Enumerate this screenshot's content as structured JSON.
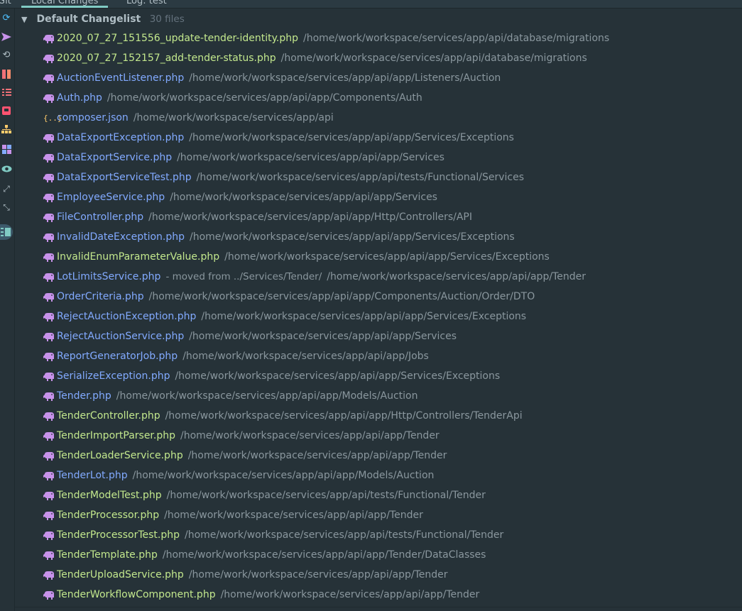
{
  "tabs": [
    {
      "label": "Git"
    },
    {
      "label": "Local Changes"
    },
    {
      "label": "Log: test"
    }
  ],
  "toolbar_icons": [
    "refresh-icon",
    "commit-arrow-icon",
    "rollback-icon",
    "diff-icon",
    "changelist-icon",
    "shelve-icon",
    "group-by-icon",
    "layout-icon",
    "preview-eye-icon",
    "expand-all-icon",
    "collapse-all-icon",
    "details-panel-icon"
  ],
  "colors": {
    "modified": "#82aaff",
    "added": "#c3e88d",
    "php_icon": "#c792ea",
    "accent": "#80cbc4"
  },
  "changelist": {
    "name": "Default Changelist",
    "count_label": "30 files",
    "files": [
      {
        "name": "2020_07_27_151556_update-tender-identity.php",
        "path": "/home/work/workspace/services/app/api/database/migrations",
        "status": "added",
        "icon": "php-elephant-icon"
      },
      {
        "name": "2020_07_27_152157_add-tender-status.php",
        "path": "/home/work/workspace/services/app/api/database/migrations",
        "status": "added",
        "icon": "php-elephant-icon"
      },
      {
        "name": "AuctionEventListener.php",
        "path": "/home/work/workspace/services/app/api/app/Listeners/Auction",
        "status": "modified",
        "icon": "php-elephant-icon"
      },
      {
        "name": "Auth.php",
        "path": "/home/work/workspace/services/app/api/app/Components/Auth",
        "status": "modified",
        "icon": "php-elephant-icon"
      },
      {
        "name": "composer.json",
        "path": "/home/work/workspace/services/app/api",
        "status": "modified",
        "icon": "json-braces-icon"
      },
      {
        "name": "DataExportException.php",
        "path": "/home/work/workspace/services/app/api/app/Services/Exceptions",
        "status": "modified",
        "icon": "php-elephant-icon"
      },
      {
        "name": "DataExportService.php",
        "path": "/home/work/workspace/services/app/api/app/Services",
        "status": "modified",
        "icon": "php-elephant-icon"
      },
      {
        "name": "DataExportServiceTest.php",
        "path": "/home/work/workspace/services/app/api/tests/Functional/Services",
        "status": "modified",
        "icon": "php-elephant-icon"
      },
      {
        "name": "EmployeeService.php",
        "path": "/home/work/workspace/services/app/api/app/Services",
        "status": "modified",
        "icon": "php-elephant-icon"
      },
      {
        "name": "FileController.php",
        "path": "/home/work/workspace/services/app/api/app/Http/Controllers/API",
        "status": "modified",
        "icon": "php-elephant-icon"
      },
      {
        "name": "InvalidDateException.php",
        "path": "/home/work/workspace/services/app/api/app/Services/Exceptions",
        "status": "modified",
        "icon": "php-elephant-icon"
      },
      {
        "name": "InvalidEnumParameterValue.php",
        "path": "/home/work/workspace/services/app/api/app/Services/Exceptions",
        "status": "added",
        "icon": "php-elephant-icon"
      },
      {
        "name": "LotLimitsService.php",
        "note": "- moved from ../Services/Tender/",
        "path": "/home/work/workspace/services/app/api/app/Tender",
        "status": "modified",
        "icon": "php-elephant-icon"
      },
      {
        "name": "OrderCriteria.php",
        "path": "/home/work/workspace/services/app/api/app/Components/Auction/Order/DTO",
        "status": "modified",
        "icon": "php-elephant-icon"
      },
      {
        "name": "RejectAuctionException.php",
        "path": "/home/work/workspace/services/app/api/app/Services/Exceptions",
        "status": "modified",
        "icon": "php-elephant-icon"
      },
      {
        "name": "RejectAuctionService.php",
        "path": "/home/work/workspace/services/app/api/app/Services",
        "status": "modified",
        "icon": "php-elephant-icon"
      },
      {
        "name": "ReportGeneratorJob.php",
        "path": "/home/work/workspace/services/app/api/app/Jobs",
        "status": "modified",
        "icon": "php-elephant-icon"
      },
      {
        "name": "SerializeException.php",
        "path": "/home/work/workspace/services/app/api/app/Services/Exceptions",
        "status": "modified",
        "icon": "php-elephant-icon"
      },
      {
        "name": "Tender.php",
        "path": "/home/work/workspace/services/app/api/app/Models/Auction",
        "status": "modified",
        "icon": "php-elephant-icon"
      },
      {
        "name": "TenderController.php",
        "path": "/home/work/workspace/services/app/api/app/Http/Controllers/TenderApi",
        "status": "added",
        "icon": "php-elephant-icon"
      },
      {
        "name": "TenderImportParser.php",
        "path": "/home/work/workspace/services/app/api/app/Tender",
        "status": "added",
        "icon": "php-elephant-icon"
      },
      {
        "name": "TenderLoaderService.php",
        "path": "/home/work/workspace/services/app/api/app/Tender",
        "status": "added",
        "icon": "php-elephant-icon"
      },
      {
        "name": "TenderLot.php",
        "path": "/home/work/workspace/services/app/api/app/Models/Auction",
        "status": "modified",
        "icon": "php-elephant-icon"
      },
      {
        "name": "TenderModelTest.php",
        "path": "/home/work/workspace/services/app/api/tests/Functional/Tender",
        "status": "added",
        "icon": "php-elephant-icon"
      },
      {
        "name": "TenderProcessor.php",
        "path": "/home/work/workspace/services/app/api/app/Tender",
        "status": "added",
        "icon": "php-elephant-icon"
      },
      {
        "name": "TenderProcessorTest.php",
        "path": "/home/work/workspace/services/app/api/tests/Functional/Tender",
        "status": "added",
        "icon": "php-elephant-icon"
      },
      {
        "name": "TenderTemplate.php",
        "path": "/home/work/workspace/services/app/api/app/Tender/DataClasses",
        "status": "added",
        "icon": "php-elephant-icon"
      },
      {
        "name": "TenderUploadService.php",
        "path": "/home/work/workspace/services/app/api/app/Tender",
        "status": "added",
        "icon": "php-elephant-icon"
      },
      {
        "name": "TenderWorkflowComponent.php",
        "path": "/home/work/workspace/services/app/api/app/Tender",
        "status": "added",
        "icon": "php-elephant-icon"
      }
    ]
  }
}
